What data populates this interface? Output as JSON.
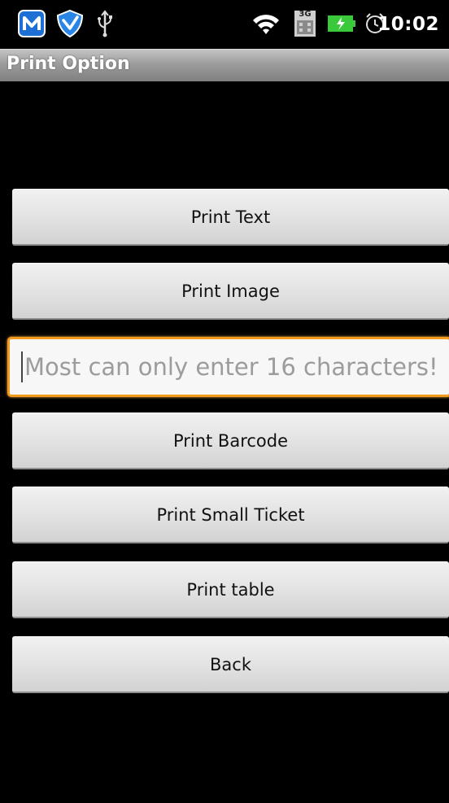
{
  "status_bar": {
    "time": "10:02",
    "icons": [
      "m-app-icon",
      "shield-icon",
      "usb-icon",
      "wifi-icon",
      "sim-icon",
      "battery-charging-icon",
      "alarm-icon"
    ],
    "sim_label": "3G"
  },
  "title_bar": {
    "title": "Print Option"
  },
  "buttons": {
    "print_text": "Print Text",
    "print_image": "Print Image",
    "print_barcode": "Print Barcode",
    "print_small_ticket": "Print Small Ticket",
    "print_table": "Print table",
    "back": "Back"
  },
  "barcode_input": {
    "value": "",
    "placeholder": "Most can only enter 16 characters!"
  },
  "colors": {
    "focus_border": "#f49a1e",
    "battery": "#39c93b",
    "app_icon": "#2a7ee0"
  }
}
